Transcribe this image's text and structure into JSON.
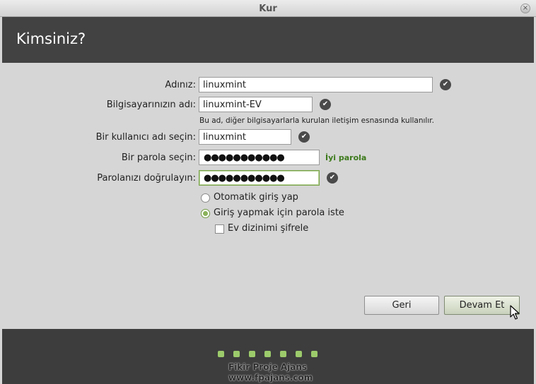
{
  "window": {
    "title": "Kur",
    "close_glyph": "×"
  },
  "header": {
    "title": "Kimsiniz?"
  },
  "form": {
    "name_label": "Adınız:",
    "name_value": "linuxmint",
    "computer_label": "Bilgisayarınızın adı:",
    "computer_value": "linuxmint-EV",
    "computer_hint": "Bu ad, diğer bilgisayarlarla kurulan iletişim esnasında kullanılır.",
    "username_label": "Bir kullanıcı adı seçin:",
    "username_value": "linuxmint",
    "password_label": "Bir parola seçin:",
    "password_dots": "●●●●●●●●●●●",
    "password_strength": "İyi parola",
    "confirm_label": "Parolanızı doğrulayın:",
    "confirm_dots": "●●●●●●●●●●●",
    "check_glyph": "✔"
  },
  "login_options": {
    "auto_login": {
      "label": "Otomatik giriş yap",
      "selected": false
    },
    "require_password": {
      "label": "Giriş yapmak için parola iste",
      "selected": true
    },
    "encrypt_home": {
      "label": "Ev dizinimi şifrele",
      "checked": false
    }
  },
  "buttons": {
    "back": "Geri",
    "continue": "Devam Et"
  },
  "footer": {
    "progress": {
      "total_steps": 7
    },
    "watermark_line1": "Fikir Proje Ajans",
    "watermark_line2": "www.fpajans.com"
  },
  "colors": {
    "header_bg": "#424242",
    "accent_green": "#8ab35a",
    "strength_green": "#3d7a1c"
  }
}
